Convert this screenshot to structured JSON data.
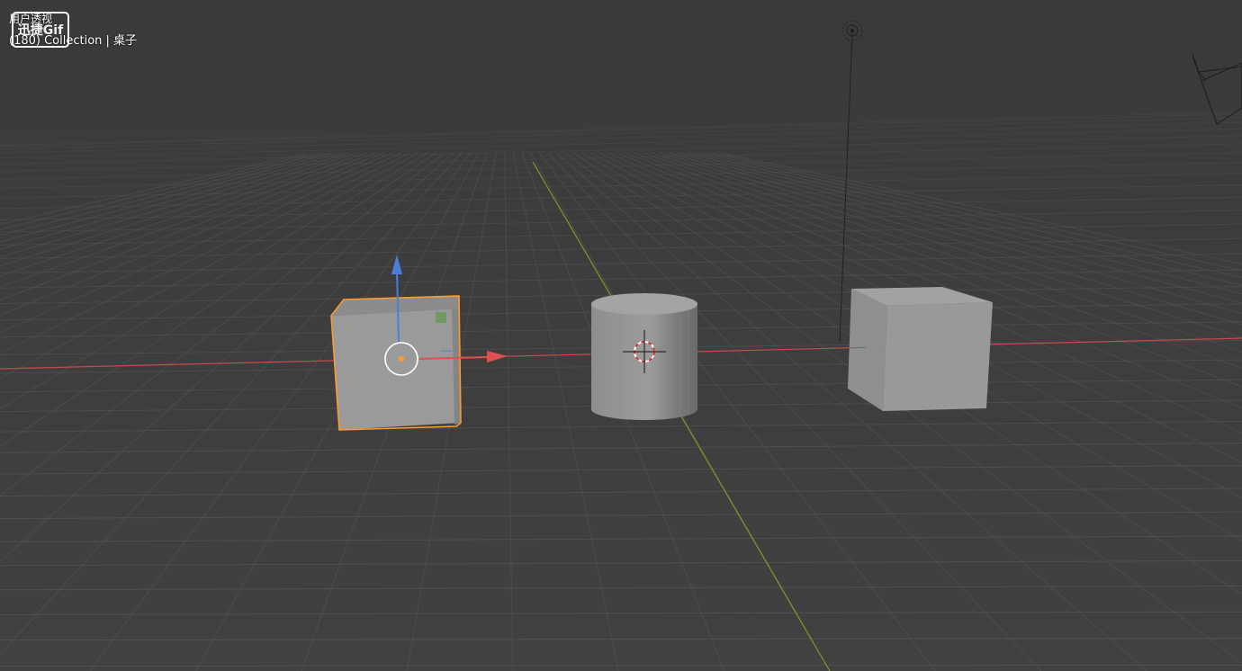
{
  "header": {
    "view_label": "用户透视",
    "collection_label": "(180) Collection | 桌子"
  },
  "watermark": {
    "text": "迅捷Gif"
  },
  "scene": {
    "objects": [
      {
        "name": "cube-selected",
        "selected": true
      },
      {
        "name": "cylinder",
        "selected": false
      },
      {
        "name": "cube",
        "selected": false
      },
      {
        "name": "light",
        "selected": false
      },
      {
        "name": "camera",
        "selected": false
      }
    ],
    "gizmo": {
      "type": "move",
      "axes": [
        "x",
        "z"
      ]
    },
    "colors": {
      "background": "#3d3d3d",
      "grid": "#575757",
      "x_axis": "#c84a4a",
      "y_axis": "#7a9a2a",
      "gizmo_x": "#e05050",
      "gizmo_z": "#4a7fd8",
      "selection": "#ff9a2e",
      "object": "#9a9a9a",
      "cursor_red": "#cc3030"
    }
  }
}
